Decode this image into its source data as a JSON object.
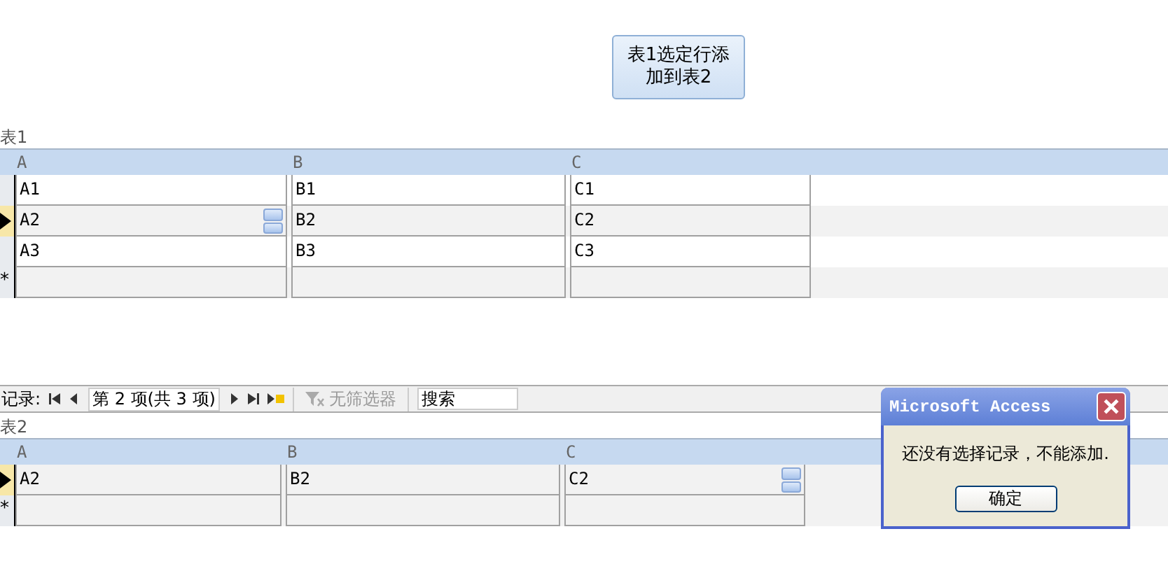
{
  "action_button": "表1选定行添加到表2",
  "tables": [
    {
      "label": "表1",
      "columns": [
        "A",
        "B",
        "C"
      ],
      "rows": [
        {
          "current": false,
          "cells": [
            {
              "text": "A1",
              "spinner": false
            },
            {
              "text": "B1",
              "spinner": false
            },
            {
              "text": "C1",
              "spinner": false
            }
          ]
        },
        {
          "current": true,
          "cells": [
            {
              "text": "A2",
              "spinner": true
            },
            {
              "text": "B2",
              "spinner": false
            },
            {
              "text": "C2",
              "spinner": false
            }
          ]
        },
        {
          "current": false,
          "cells": [
            {
              "text": "A3",
              "spinner": false
            },
            {
              "text": "B3",
              "spinner": false
            },
            {
              "text": "C3",
              "spinner": false
            }
          ]
        }
      ],
      "new_row_marker": "*"
    },
    {
      "label": "表2",
      "columns": [
        "A",
        "B",
        "C"
      ],
      "rows": [
        {
          "current": true,
          "cells": [
            {
              "text": "A2",
              "spinner": false
            },
            {
              "text": "B2",
              "spinner": false
            },
            {
              "text": "C2",
              "spinner": true
            }
          ]
        }
      ],
      "new_row_marker": "*"
    }
  ],
  "navigator": {
    "label": "记录:",
    "position": "第 2 项(共 3 项)",
    "filter": {
      "label": "无筛选器",
      "disabled": true
    },
    "search": {
      "placeholder": "搜索"
    }
  },
  "dialog": {
    "title": "Microsoft Access",
    "message": "还没有选择记录，不能添加.",
    "ok": "确定"
  }
}
